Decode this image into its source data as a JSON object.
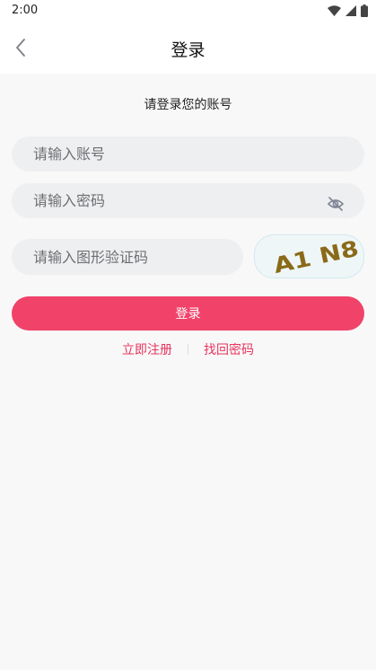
{
  "status_bar": {
    "time": "2:00",
    "icons": [
      "wifi-icon",
      "cellular-signal-icon",
      "battery-icon"
    ]
  },
  "nav": {
    "title": "登录",
    "back_icon": "chevron-left-icon"
  },
  "form": {
    "subtitle": "请登录您的账号",
    "account_placeholder": "请输入账号",
    "password_placeholder": "请输入密码",
    "password_toggle_icon": "eye-off-icon",
    "captcha_placeholder": "请输入图形验证码",
    "captcha_text": "A1 N8",
    "login_label": "登录",
    "register_link": "立即注册",
    "forgot_link": "找回密码"
  },
  "colors": {
    "accent": "#f1436a",
    "link": "#e8345e",
    "input_bg": "#eeeff1",
    "page_bg": "#f8f8f8",
    "captcha_glyph": "#8a6a18"
  }
}
